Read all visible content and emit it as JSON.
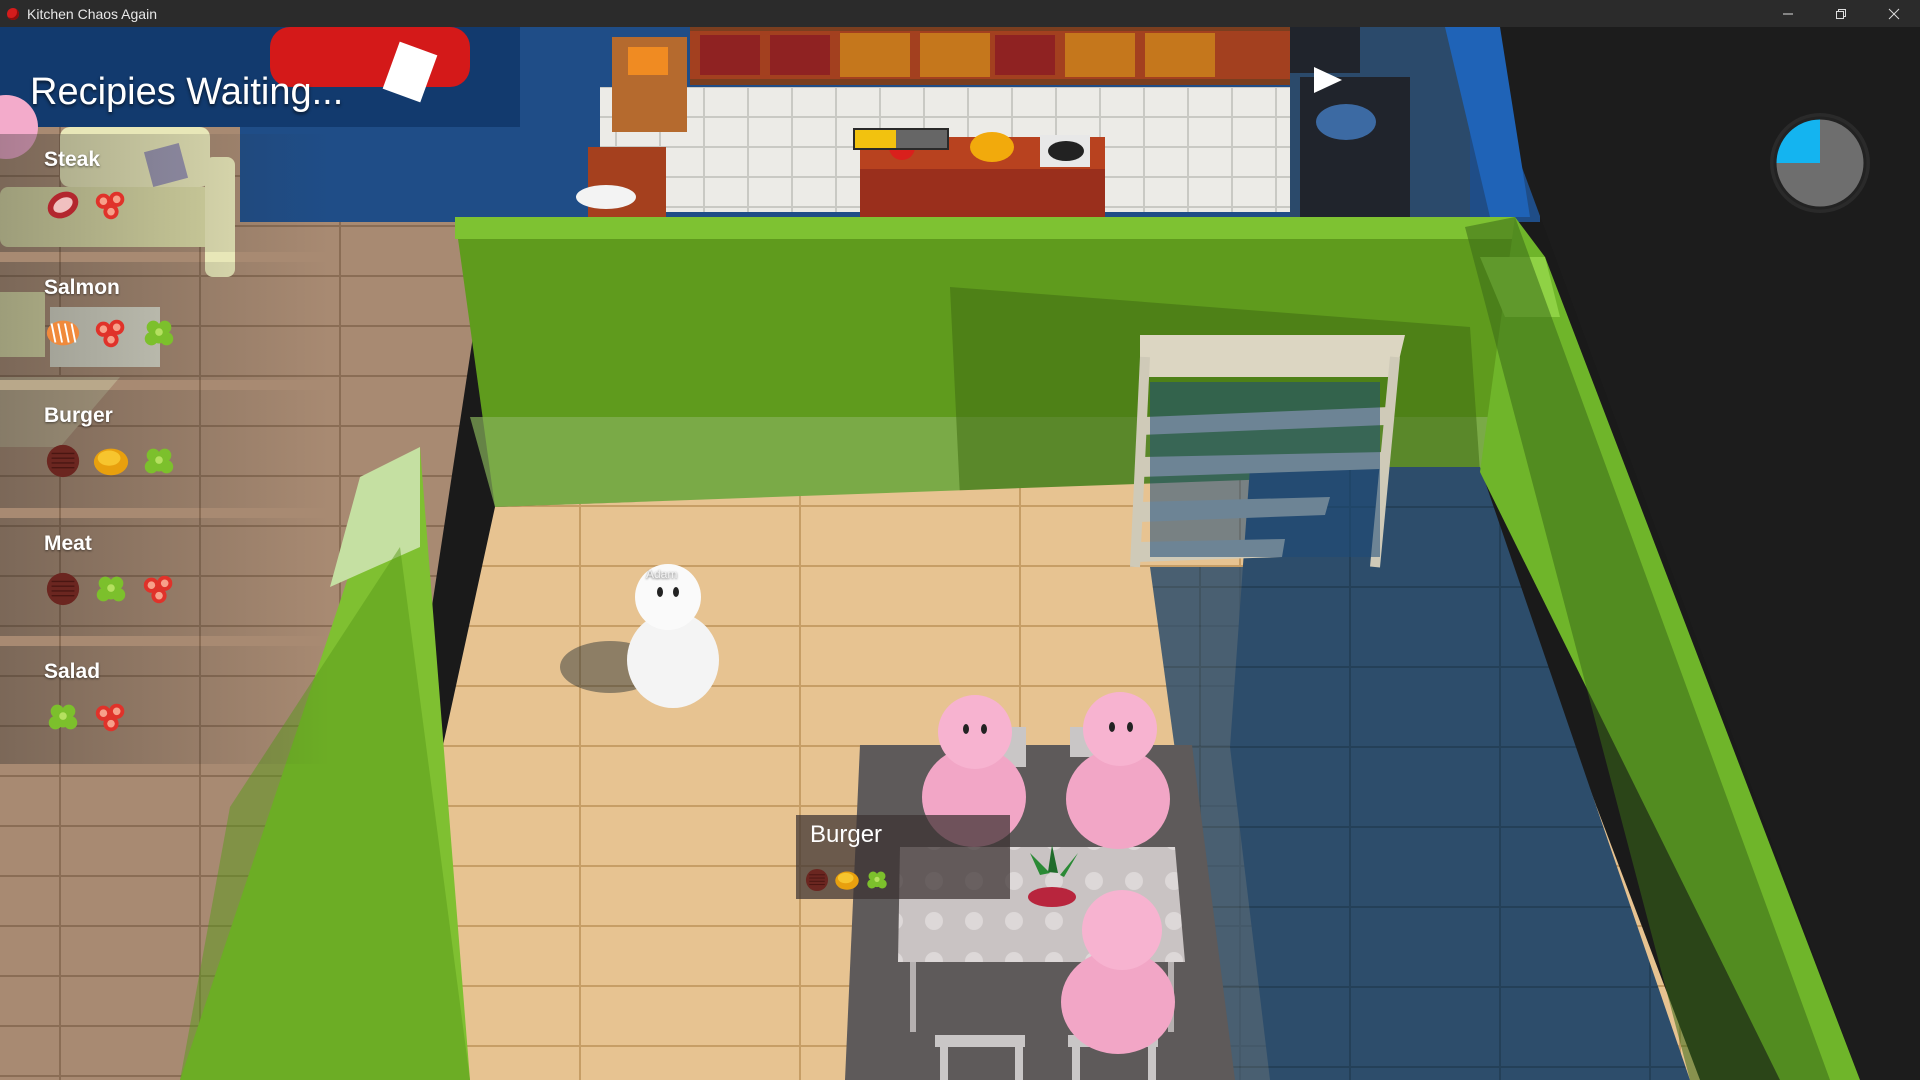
{
  "window": {
    "title": "Kitchen Chaos Again",
    "icon": "tomato-icon",
    "controls": [
      "minimize-icon",
      "restore-icon",
      "close-icon"
    ]
  },
  "hud": {
    "title": "Recipies Waiting...",
    "recipes": [
      {
        "name": "Steak",
        "ingredients": [
          "steak-icon",
          "tomato-slice-icon"
        ]
      },
      {
        "name": "Salmon",
        "ingredients": [
          "salmon-icon",
          "tomato-slice-icon",
          "lettuce-icon"
        ]
      },
      {
        "name": "Burger",
        "ingredients": [
          "patty-icon",
          "bun-icon",
          "lettuce-icon"
        ]
      },
      {
        "name": "Meat",
        "ingredients": [
          "patty-icon",
          "lettuce-icon",
          "tomato-slice-icon"
        ]
      },
      {
        "name": "Salad",
        "ingredients": [
          "lettuce-icon",
          "tomato-slice-icon"
        ]
      }
    ],
    "timer_remaining_fraction": 0.25,
    "play_button_icon": "play-icon"
  },
  "world": {
    "player_name": "Adam",
    "cooking_progress": 0.45,
    "order": {
      "name": "Burger",
      "ingredients": [
        "patty-icon",
        "bun-icon",
        "lettuce-icon"
      ]
    }
  },
  "colors": {
    "accent_green": "#6fb52a",
    "timer_blue": "#14b4f0",
    "floor_wood": "#e8c48f",
    "floor_blue": "#2c4a66",
    "progress_yellow": "#f2c20f"
  }
}
